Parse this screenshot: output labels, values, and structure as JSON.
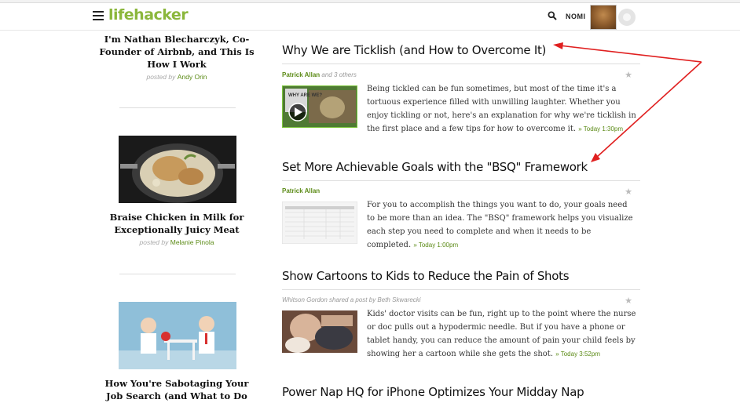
{
  "header": {
    "logo": "lifehacker",
    "username": "NOMI",
    "icons": [
      "menu-icon",
      "search-icon",
      "notification-icon"
    ]
  },
  "sidebar": {
    "items": [
      {
        "title": "I'm Nathan Blecharczyk, Co-Founder of Airbnb, and This Is How I Work",
        "posted_by": "posted by",
        "author": "Andy Orin"
      },
      {
        "title": "Braise Chicken in Milk for Exceptionally Juicy Meat",
        "posted_by": "posted by",
        "author": "Melanie Pinola"
      },
      {
        "title": "How You're Sabotaging Your Job Search (and What to Do"
      }
    ]
  },
  "posts": [
    {
      "title": "Why We are Ticklish (and How to Overcome It)",
      "author": "Patrick Allan",
      "author_extra": "and 3 others",
      "body": "Being tickled can be fun sometimes, but most of the time it's a tortuous experience filled with unwilling laughter. Whether you enjoy tickling or not, here's an explanation for why we're ticklish in the first place and a few tips for how to overcome it.",
      "time": "» Today 1:30pm",
      "thumb_text": "WHY ARE WE?"
    },
    {
      "title": "Set More Achievable Goals with the \"BSQ\" Framework",
      "author": "Patrick Allan",
      "body": "For you to accomplish the things you want to do, your goals need to be more than an idea. The \"BSQ\" framework helps you visualize each step you need to complete and when it needs to be completed.",
      "time": "» Today 1:00pm"
    },
    {
      "title": "Show Cartoons to Kids to Reduce the Pain of Shots",
      "author": "Whitson Gordon",
      "author_extra": "shared a post by Beth Skwarecki",
      "body": "Kids' doctor visits can be fun, right up to the point where the nurse or doc pulls out a hypodermic needle. But if you have a phone or tablet handy, you can reduce the amount of pain your child feels by showing her a cartoon while she gets the shot.",
      "time": "» Today 3:52pm"
    },
    {
      "title": "Power Nap HQ for iPhone Optimizes Your Midday Nap"
    }
  ],
  "colors": {
    "brand_green": "#8bb73c",
    "link_green": "#5c8b17",
    "annotation_red": "#e02020"
  }
}
